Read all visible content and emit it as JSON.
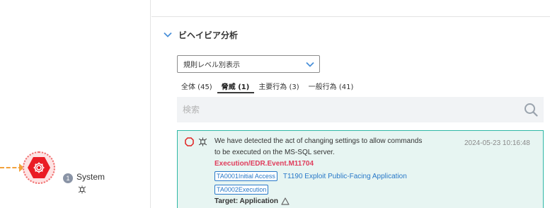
{
  "graph": {
    "node": {
      "badge": "1",
      "label": "System",
      "icon": "gear-icon",
      "sub_icon": "process-icon"
    }
  },
  "section": {
    "title": "ビヘイビア分析",
    "icon": "chevron-down-icon"
  },
  "filter": {
    "selected": "規則レベル別表示"
  },
  "tabs": [
    {
      "label": "全体 (45)",
      "active": false
    },
    {
      "label": "脅威 (1)",
      "active": true
    },
    {
      "label": "主要行為 (3)",
      "active": false
    },
    {
      "label": "一般行為 (41)",
      "active": false
    }
  ],
  "search": {
    "placeholder": "検索"
  },
  "alert": {
    "description": "We have detected the act of changing settings to allow commands to be executed on the MS-SQL server.",
    "timestamp": "2024-05-23 10:16:48",
    "event": "Execution/EDR.Event.M11704",
    "tactic1": "TA0001Initial Access",
    "technique1": "T1190 Exploit Public-Facing Application",
    "tactic2": "TA0002Execution",
    "target": "Target: Application"
  },
  "colors": {
    "threat_red": "#ea1c24",
    "accent_blue": "#2878c8",
    "card_border": "#2fb8a6",
    "event_red": "#e03d5c",
    "edge_orange": "#f2a23c"
  }
}
